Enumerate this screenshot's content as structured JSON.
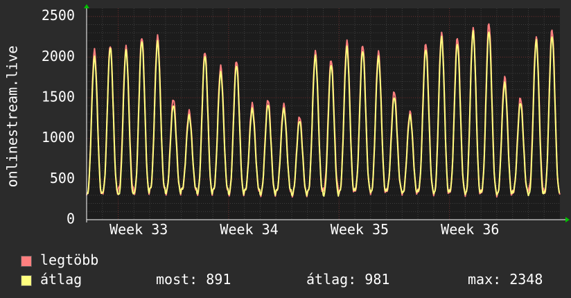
{
  "chart_data": {
    "type": "line",
    "ylabel": "onlinestream.live",
    "ylim": [
      0,
      2600
    ],
    "yticks": [
      0,
      500,
      1000,
      1500,
      2000,
      2500
    ],
    "xticks": [
      "Week 33",
      "Week 34",
      "Week 35",
      "Week 36"
    ],
    "grid": true,
    "series": [
      {
        "name": "legtöbb",
        "color": "#ff7f7f",
        "daily_peaks": [
          2080,
          2150,
          2120,
          2250,
          2250,
          1490,
          1330,
          2070,
          1880,
          1960,
          1420,
          1480,
          1410,
          1270,
          2060,
          1970,
          2190,
          2150,
          2060,
          1580,
          1320,
          2170,
          2290,
          2240,
          2350,
          2420,
          1750,
          1500,
          2240,
          2340
        ]
      },
      {
        "name": "átlag",
        "color": "#ffff7f",
        "daily_peaks": [
          2000,
          2120,
          2080,
          2200,
          2190,
          1410,
          1280,
          2020,
          1810,
          1900,
          1360,
          1420,
          1360,
          1220,
          2010,
          1910,
          2120,
          2080,
          2000,
          1510,
          1280,
          2100,
          2240,
          2170,
          2310,
          2320,
          1680,
          1440,
          2200,
          2260
        ]
      }
    ]
  },
  "legend": {
    "max_label": "legtöbb",
    "avg_label": "átlag"
  },
  "stats": {
    "now": "most: 891",
    "avg": "átlag: 981",
    "max": "max: 2348"
  },
  "colors": {
    "background": "#2b2b2b",
    "plot": "#1c1c1c",
    "grid_major": "#6b2a2a",
    "grid_minor": "#3f3f3f",
    "axis": "#ffffff",
    "arrow": "#00c000"
  }
}
